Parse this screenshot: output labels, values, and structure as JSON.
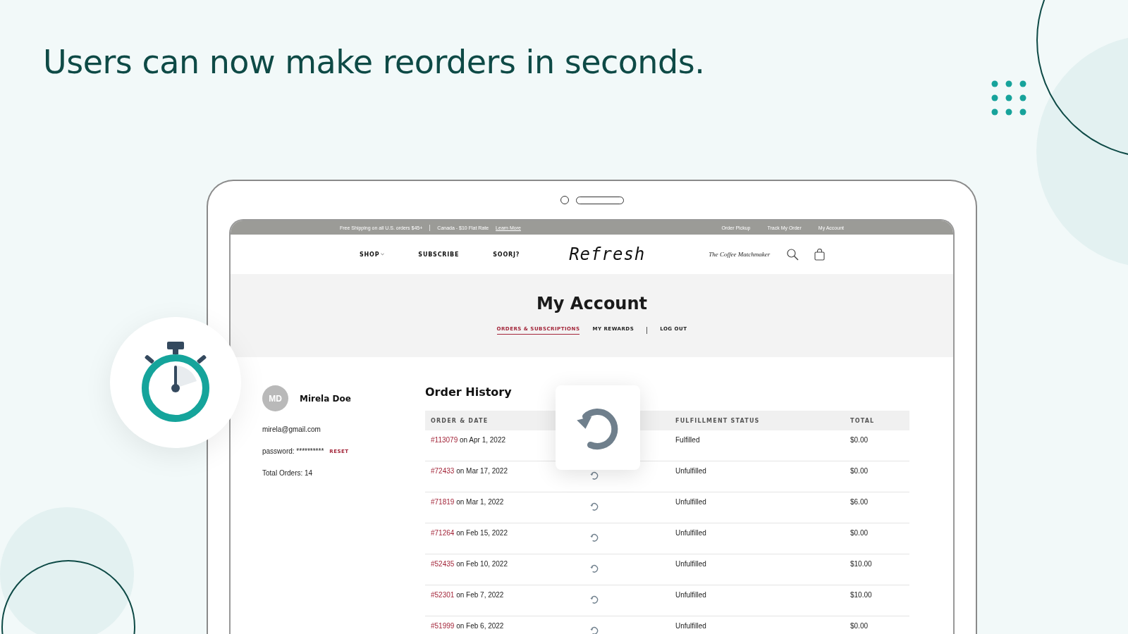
{
  "headline": "Users can now make reorders in seconds.",
  "announcement": {
    "left": [
      "Free Shipping on all U.S. orders $45+",
      "Canada - $10 Flat Rate"
    ],
    "link": "Learn More",
    "right": [
      "Order Pickup",
      "Track My Order",
      "My Account"
    ]
  },
  "nav": {
    "items": [
      {
        "label": "SHOP",
        "dropdown": true
      },
      {
        "label": "SUBSCRIBE",
        "dropdown": false
      },
      {
        "label": "SOORJ?",
        "dropdown": false
      }
    ],
    "logo": "Refresh",
    "tagline": "The Coffee Matchmaker"
  },
  "page_title": "My Account",
  "tabs": [
    {
      "label": "ORDERS & SUBSCRIPTIONS",
      "selected": true
    },
    {
      "label": "MY REWARDS",
      "selected": false
    },
    {
      "label": "LOG OUT",
      "selected": false
    }
  ],
  "profile": {
    "initials": "MD",
    "name": "Mirela Doe",
    "email": "mirela@gmail.com",
    "password_label": "password: **********",
    "reset": "RESET",
    "total_orders": "Total Orders: 14"
  },
  "order_history": {
    "title": "Order History",
    "columns": [
      "ORDER & DATE",
      "FULFILLMENT STATUS",
      "TOTAL"
    ],
    "rows": [
      {
        "number": "#113079",
        "date": "on Apr 1, 2022",
        "status": "Fulfilled",
        "total": "$0.00"
      },
      {
        "number": "#72433",
        "date": "on Mar 17, 2022",
        "status": "Unfulfilled",
        "total": "$0.00"
      },
      {
        "number": "#71819",
        "date": "on Mar 1, 2022",
        "status": "Unfulfilled",
        "total": "$6.00"
      },
      {
        "number": "#71264",
        "date": "on Feb 15, 2022",
        "status": "Unfulfilled",
        "total": "$0.00"
      },
      {
        "number": "#52435",
        "date": "on Feb 10, 2022",
        "status": "Unfulfilled",
        "total": "$10.00"
      },
      {
        "number": "#52301",
        "date": "on Feb 7, 2022",
        "status": "Unfulfilled",
        "total": "$10.00"
      },
      {
        "number": "#51999",
        "date": "on Feb 6, 2022",
        "status": "Unfulfilled",
        "total": "$0.00"
      }
    ]
  }
}
